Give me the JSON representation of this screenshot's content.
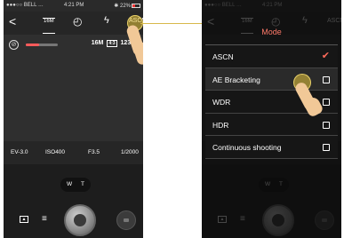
{
  "status": {
    "carrier": "●●●○○ BELL …",
    "time": "4:21 PM",
    "bluetooth": "✱ 22%"
  },
  "toolbar": {
    "back": "<",
    "resolution": "16M",
    "timer": "◴",
    "flash": "ϟ",
    "mode": "ASCN"
  },
  "viewfinder": {
    "icon": "⊘",
    "size": "16M",
    "ratio": "4:3",
    "remaining": "12345"
  },
  "params": {
    "ev": "EV-3.0",
    "iso": "ISO400",
    "aperture": "F3.5",
    "shutter": "1/2000"
  },
  "zoom": {
    "wide": "W",
    "tele": "T"
  },
  "modes": {
    "title": "Mode",
    "items": [
      {
        "label": "ASCN",
        "checked": true
      },
      {
        "label": "AE Bracketing",
        "checked": false
      },
      {
        "label": "WDR",
        "checked": false
      },
      {
        "label": "HDR",
        "checked": false
      },
      {
        "label": "Continuous shooting",
        "checked": false
      }
    ],
    "check_glyph": "✔"
  },
  "colors": {
    "accent": "#ff6b5b",
    "tap": "#ebc83c"
  }
}
